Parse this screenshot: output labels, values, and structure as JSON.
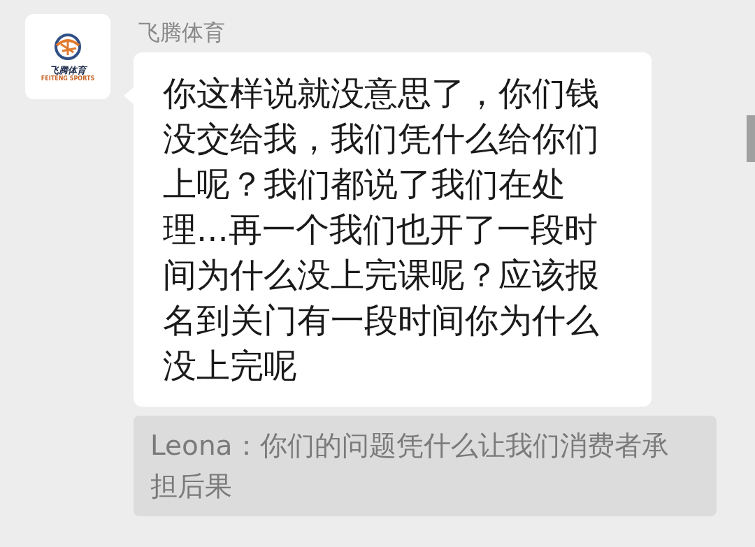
{
  "message": {
    "sender": "飞腾体育",
    "avatar": {
      "logo_text": "飞腾体育",
      "logo_subtext": "FEITENG SPORTS"
    },
    "text": "你这样说就没意思了，你们钱没交给我，我们凭什么给你们上呢？我们都说了我们在处理...再一个我们也开了一段时间为什么没上完课呢？应该报名到关门有一段时间你为什么没上完呢",
    "quote": "Leona：你们的问题凭什么让我们消费者承担后果"
  }
}
